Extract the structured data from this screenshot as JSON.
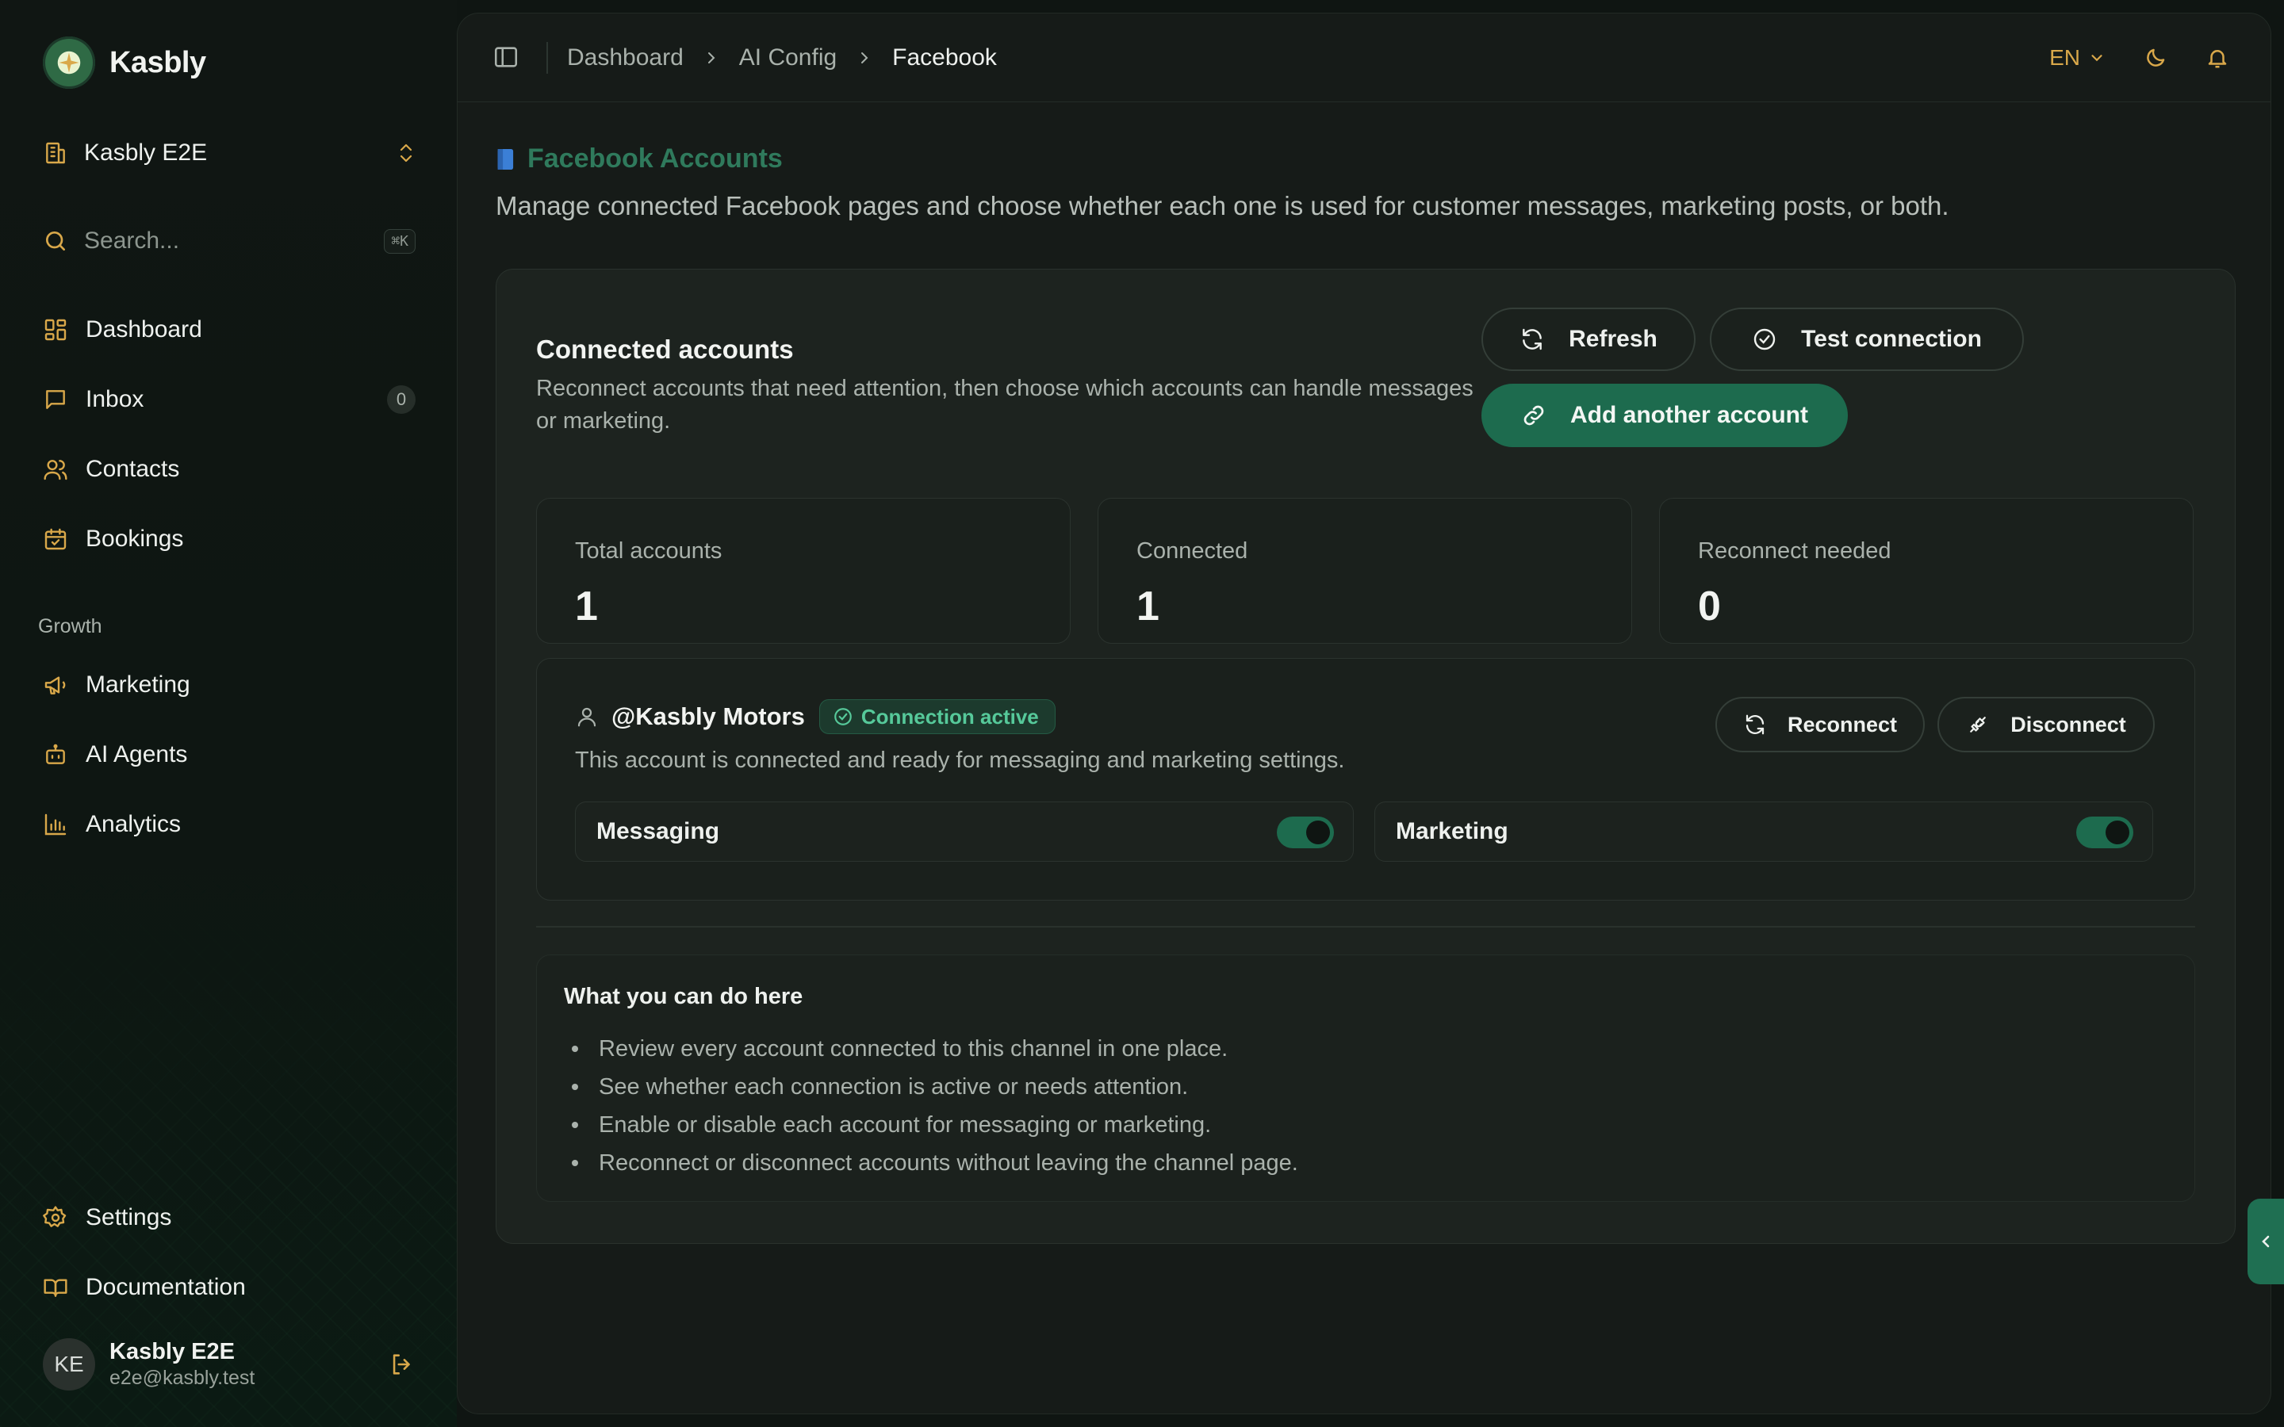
{
  "brand": {
    "name": "Kasbly"
  },
  "workspace": {
    "name": "Kasbly E2E"
  },
  "search": {
    "placeholder": "Search...",
    "shortcut": "⌘K"
  },
  "sidebar": {
    "items": [
      {
        "label": "Dashboard",
        "icon": "dashboard-icon"
      },
      {
        "label": "Inbox",
        "icon": "inbox-icon",
        "count": "0"
      },
      {
        "label": "Contacts",
        "icon": "contacts-icon"
      },
      {
        "label": "Bookings",
        "icon": "calendar-icon"
      }
    ],
    "growth_title": "Growth",
    "growth_items": [
      {
        "label": "Marketing",
        "icon": "megaphone-icon"
      },
      {
        "label": "AI Agents",
        "icon": "bot-icon"
      },
      {
        "label": "Analytics",
        "icon": "bar-chart-icon"
      }
    ],
    "bottom_items": [
      {
        "label": "Settings",
        "icon": "gear-icon"
      },
      {
        "label": "Documentation",
        "icon": "book-icon"
      }
    ]
  },
  "user": {
    "initials": "KE",
    "name": "Kasbly E2E",
    "email": "e2e@kasbly.test"
  },
  "breadcrumb": [
    "Dashboard",
    "AI Config",
    "Facebook"
  ],
  "topbar": {
    "language": "EN"
  },
  "page": {
    "title": "Facebook Accounts",
    "description": "Manage connected Facebook pages and choose whether each one is used for customer messages, marketing posts, or both."
  },
  "card": {
    "title": "Connected accounts",
    "description": "Reconnect accounts that need attention, then choose which accounts can handle messages or marketing.",
    "refresh_label": "Refresh",
    "test_label": "Test connection",
    "add_label": "Add another account"
  },
  "stats": [
    {
      "label": "Total accounts",
      "value": "1"
    },
    {
      "label": "Connected",
      "value": "1"
    },
    {
      "label": "Reconnect needed",
      "value": "0"
    }
  ],
  "account": {
    "name": "@Kasbly Motors",
    "status": "Connection active",
    "description": "This account is connected and ready for messaging and marketing settings.",
    "reconnect_label": "Reconnect",
    "disconnect_label": "Disconnect",
    "toggles": [
      {
        "label": "Messaging",
        "enabled": true
      },
      {
        "label": "Marketing",
        "enabled": true
      }
    ]
  },
  "help": {
    "title": "What you can do here",
    "items": [
      "Review every account connected to this channel in one place.",
      "See whether each connection is active or needs attention.",
      "Enable or disable each account for messaging or marketing.",
      "Reconnect or disconnect accounts without leaving the channel page."
    ]
  },
  "colors": {
    "accent": "#1d6b4e",
    "sidebar_icon": "#d9a84a",
    "success": "#56c99a"
  }
}
